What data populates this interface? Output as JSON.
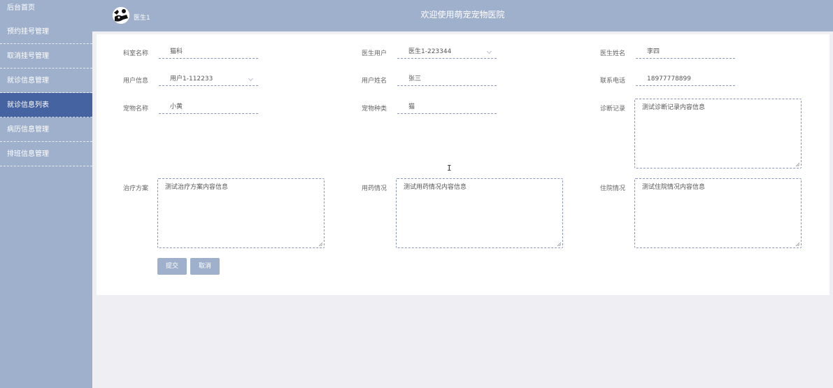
{
  "sidebar": {
    "home": "后台首页",
    "items": [
      {
        "label": "预约挂号管理"
      },
      {
        "label": "取消挂号管理"
      },
      {
        "label": "就诊信息管理"
      },
      {
        "label": "就诊信息列表"
      },
      {
        "label": "病历信息管理"
      },
      {
        "label": "排班信息管理"
      }
    ],
    "active_index": 3
  },
  "header": {
    "user_name": "医生1",
    "title": "欢迎使用萌宠宠物医院"
  },
  "form": {
    "dept_label": "科室名称",
    "dept_value": "猫科",
    "doctor_user_label": "医生用户",
    "doctor_user_value": "医生1-223344",
    "doctor_name_label": "医生姓名",
    "doctor_name_value": "李四",
    "user_info_label": "用户信息",
    "user_info_value": "用户1-112233",
    "user_name_label": "用户姓名",
    "user_name_value": "张三",
    "phone_label": "联系电话",
    "phone_value": "18977778899",
    "pet_name_label": "宠物名称",
    "pet_name_value": "小黄",
    "pet_type_label": "宠物种类",
    "pet_type_value": "猫",
    "diagnosis_label": "诊断记录",
    "diagnosis_value": "测试诊断记录内容信息",
    "treatment_label": "治疗方案",
    "treatment_value": "测试治疗方案内容信息",
    "medication_label": "用药情况",
    "medication_value": "测试用药情况内容信息",
    "hospital_label": "住院情况",
    "hospital_value": "测试住院情况内容信息"
  },
  "buttons": {
    "submit": "提交",
    "cancel": "取消"
  },
  "colors": {
    "sidebar_bg": "#9fb0cc",
    "active_bg": "#4563a0",
    "page_bg": "#eeeef3"
  }
}
